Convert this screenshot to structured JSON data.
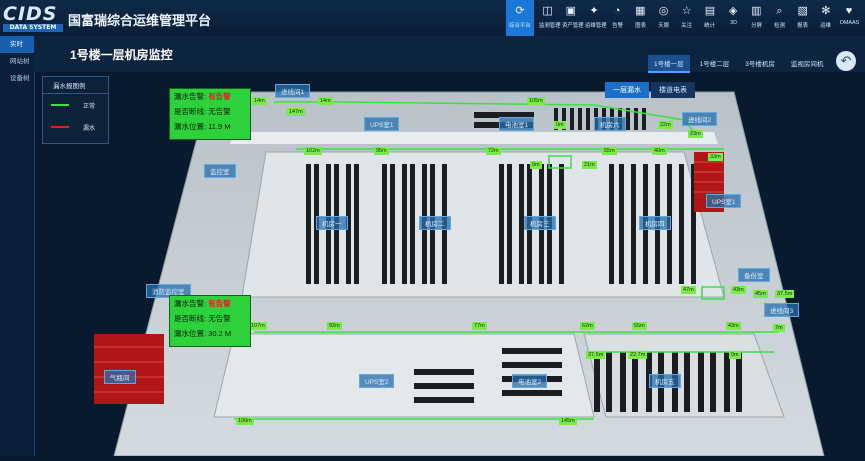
{
  "app": {
    "logo_main": "CIDS",
    "logo_sub": "DATA SYSTEM",
    "title": "国富瑞综合运维管理平台"
  },
  "nav": [
    {
      "label": "综合平台",
      "icon": "sync-icon",
      "active": true
    },
    {
      "label": "监测管理",
      "icon": "chart-icon"
    },
    {
      "label": "资产管理",
      "icon": "cube-icon"
    },
    {
      "label": "运维管理",
      "icon": "tools-icon"
    },
    {
      "label": "告警",
      "icon": "alarm-icon"
    },
    {
      "label": "图表",
      "icon": "table-icon"
    },
    {
      "label": "天眼",
      "icon": "eye-icon"
    },
    {
      "label": "关注",
      "icon": "star-icon"
    },
    {
      "label": "统计",
      "icon": "grid-icon"
    },
    {
      "label": "3D",
      "icon": "3d-icon"
    },
    {
      "label": "分屏",
      "icon": "split-icon"
    },
    {
      "label": "检测",
      "icon": "search-icon"
    },
    {
      "label": "报表",
      "icon": "report-icon"
    },
    {
      "label": "运维",
      "icon": "gear-icon"
    },
    {
      "label": "DMAAS",
      "icon": "heart-icon"
    },
    {
      "label": "退出",
      "icon": "exit-icon"
    }
  ],
  "sidebar": {
    "items": [
      {
        "label": "实时",
        "active": true
      },
      {
        "label": "网站树"
      },
      {
        "label": "设备树"
      }
    ]
  },
  "page": {
    "title": "1号楼一层机房监控"
  },
  "floor_tabs": [
    {
      "label": "1号楼一层",
      "active": true
    },
    {
      "label": "1号楼二层"
    },
    {
      "label": "3号楼机房"
    },
    {
      "label": "监视房间机"
    }
  ],
  "mode_tabs": [
    {
      "label": "一层漏水",
      "active": true
    },
    {
      "label": "楼道电表"
    }
  ],
  "legend": {
    "title": "漏水报图例",
    "items": [
      {
        "label": "正常",
        "color": "#39e33f"
      },
      {
        "label": "漏水",
        "color": "#e21f1f"
      }
    ]
  },
  "status_boxes": [
    {
      "alarm_label": "漏水告警:",
      "alarm_value": "有告警",
      "offline_label": "是否断线:",
      "offline_value": "无告警",
      "position_label": "漏水位置:",
      "position_value": "11.9",
      "position_unit": "M"
    },
    {
      "alarm_label": "漏水告警:",
      "alarm_value": "有告警",
      "offline_label": "是否断线:",
      "offline_value": "无告警",
      "position_label": "漏水位置:",
      "position_value": "30.2",
      "position_unit": "M"
    }
  ],
  "rooms": [
    "进线间1",
    "UPS室1",
    "电池室1",
    "机房六",
    "进线间2",
    "监控室",
    "机房一",
    "机房二",
    "机房三",
    "机房四",
    "UPS室1",
    "备份室",
    "消防监控室",
    "进线间3",
    "气瓶间",
    "UPS室2",
    "电池室2",
    "机房五"
  ],
  "distances": [
    "14m",
    "14m",
    "147m",
    "105m",
    "0m",
    "22m",
    "23m",
    "33m",
    "102m",
    "95m",
    "72m",
    "55m",
    "40m",
    "0m",
    "21m",
    "47m",
    "43m",
    "45m",
    "37.5m",
    "107m",
    "92m",
    "77m",
    "62m",
    "55m",
    "43m",
    "7m",
    "37.5m",
    "22.7m",
    "0m",
    "106m",
    "145m"
  ],
  "colors": {
    "normal": "#39e33f",
    "leak": "#e21f1f",
    "accent": "#1a78d8"
  }
}
